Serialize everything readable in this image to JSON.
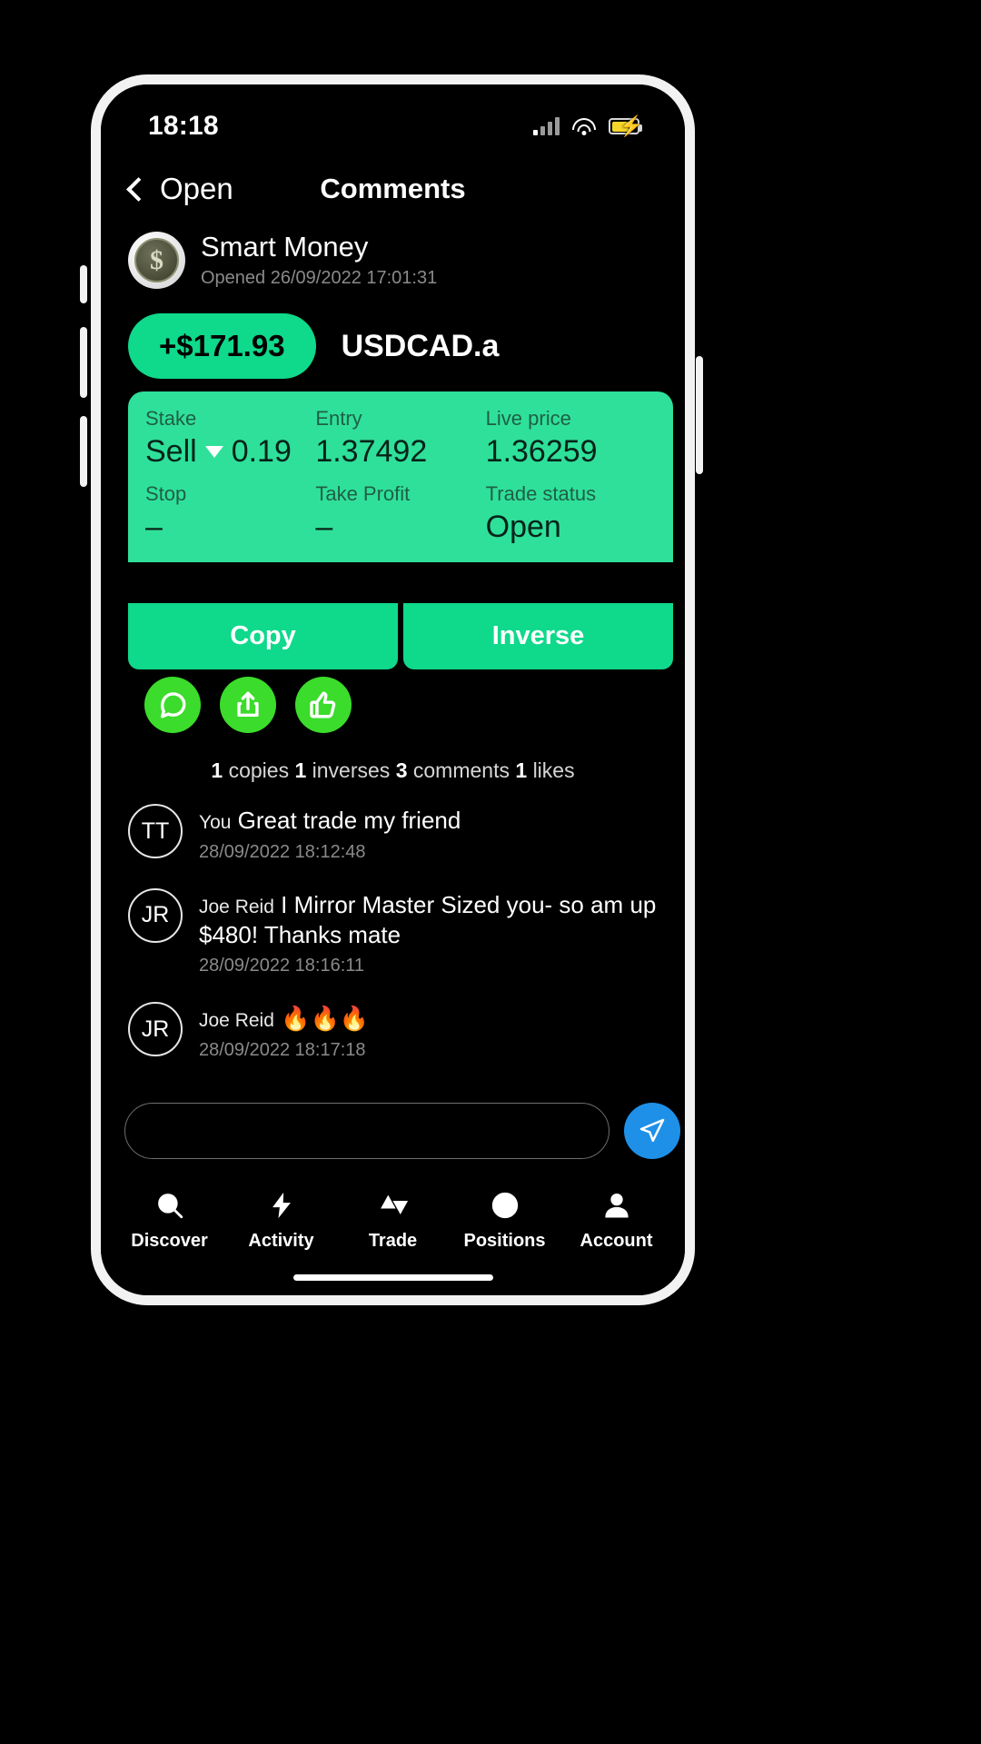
{
  "status_bar": {
    "time": "18:18",
    "signal_icon": "signal-bars-icon",
    "wifi_icon": "wifi-icon",
    "battery_icon": "battery-charging-icon"
  },
  "nav": {
    "back_label": "Open",
    "back_icon": "chevron-left-icon",
    "title": "Comments"
  },
  "trade": {
    "trader_name": "Smart Money",
    "opened_text": "Opened 26/09/2022 17:01:31",
    "avatar_symbol": "$",
    "pnl": "+$171.93",
    "symbol": "USDCAD.a",
    "fields": {
      "stake_label": "Stake",
      "stake_direction": "Sell",
      "stake_size": "0.19",
      "entry_label": "Entry",
      "entry_value": "1.37492",
      "live_price_label": "Live price",
      "live_price_value": "1.36259",
      "stop_label": "Stop",
      "stop_value": "–",
      "take_profit_label": "Take Profit",
      "take_profit_value": "–",
      "trade_status_label": "Trade status",
      "trade_status_value": "Open"
    },
    "copy_label": "Copy",
    "inverse_label": "Inverse"
  },
  "reactions": {
    "comment_icon": "comment-bubble-icon",
    "share_icon": "share-upload-icon",
    "like_icon": "thumbs-up-icon",
    "stats": {
      "copies_count": "1",
      "copies_label": "copies",
      "inverses_count": "1",
      "inverses_label": "inverses",
      "comments_count": "3",
      "comments_label": "comments",
      "likes_count": "1",
      "likes_label": "likes"
    }
  },
  "comments": [
    {
      "initials": "TT",
      "author": "You",
      "text": "Great trade my friend",
      "time": "28/09/2022 18:12:48"
    },
    {
      "initials": "JR",
      "author": "Joe Reid",
      "text": "I Mirror Master Sized you-  so am up $480! Thanks mate",
      "time": "28/09/2022 18:16:11"
    },
    {
      "initials": "JR",
      "author": "Joe Reid",
      "text": "🔥🔥🔥",
      "time": "28/09/2022 18:17:18"
    }
  ],
  "composer": {
    "input_value": "",
    "placeholder": "",
    "send_icon": "send-paper-plane-icon"
  },
  "tab_bar": {
    "items": [
      {
        "label": "Discover",
        "icon": "search-icon"
      },
      {
        "label": "Activity",
        "icon": "lightning-bolt-icon"
      },
      {
        "label": "Trade",
        "icon": "triangles-updown-icon"
      },
      {
        "label": "Positions",
        "icon": "target-dot-icon"
      },
      {
        "label": "Account",
        "icon": "person-icon"
      }
    ]
  },
  "colors": {
    "accent_green": "#0fd98b",
    "card_green": "#2fe09a",
    "reaction_green": "#3bdc2b",
    "send_blue": "#1e90e8",
    "battery_yellow": "#f5d52a"
  }
}
